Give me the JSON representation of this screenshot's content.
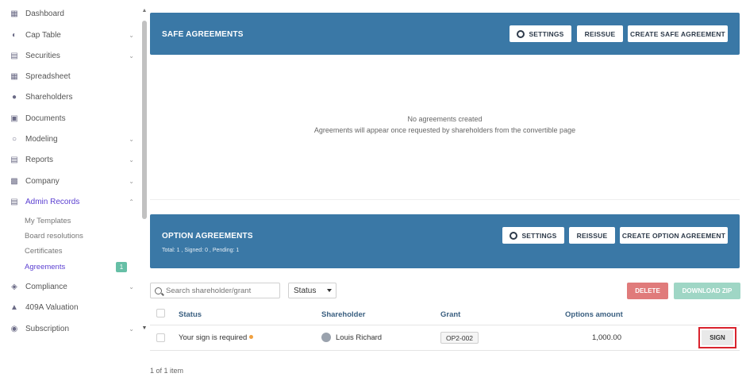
{
  "sidebar": {
    "items": [
      {
        "label": "Dashboard",
        "icon": "dashboard-icon",
        "chevron": false
      },
      {
        "label": "Cap Table",
        "icon": "pie-chart-icon",
        "chevron": true
      },
      {
        "label": "Securities",
        "icon": "clipboard-icon",
        "chevron": true
      },
      {
        "label": "Spreadsheet",
        "icon": "grid-icon",
        "chevron": false
      },
      {
        "label": "Shareholders",
        "icon": "user-icon",
        "chevron": false
      },
      {
        "label": "Documents",
        "icon": "folder-icon",
        "chevron": false
      },
      {
        "label": "Modeling",
        "icon": "lightbulb-icon",
        "chevron": true
      },
      {
        "label": "Reports",
        "icon": "report-icon",
        "chevron": true
      },
      {
        "label": "Company",
        "icon": "building-icon",
        "chevron": true
      },
      {
        "label": "Admin Records",
        "icon": "records-icon",
        "chevron": true,
        "active": true
      },
      {
        "label": "Compliance",
        "icon": "shield-check-icon",
        "chevron": true
      },
      {
        "label": "409A Valuation",
        "icon": "chart-icon",
        "chevron": false
      },
      {
        "label": "Subscription",
        "icon": "dollar-icon",
        "chevron": true
      }
    ],
    "sub_items": [
      {
        "label": "My Templates"
      },
      {
        "label": "Board resolutions"
      },
      {
        "label": "Certificates"
      },
      {
        "label": "Agreements",
        "active": true,
        "badge": "1"
      }
    ]
  },
  "safe": {
    "title": "SAFE AGREEMENTS",
    "settings_label": "SETTINGS",
    "reissue_label": "REISSUE",
    "create_label": "CREATE SAFE AGREEMENT",
    "empty_title": "No agreements created",
    "empty_desc": "Agreements will appear once requested by shareholders from the convertible page"
  },
  "option": {
    "title": "OPTION AGREEMENTS",
    "summary": "Total: 1 , Signed: 0 , Pending: 1",
    "settings_label": "SETTINGS",
    "reissue_label": "REISSUE",
    "create_label": "CREATE OPTION AGREEMENT"
  },
  "toolbar": {
    "search_placeholder": "Search shareholder/grant",
    "status_label": "Status",
    "delete_label": "DELETE",
    "download_label": "DOWNLOAD ZIP"
  },
  "table": {
    "headers": {
      "status": "Status",
      "shareholder": "Shareholder",
      "grant": "Grant",
      "options_amount": "Options amount"
    },
    "rows": [
      {
        "status": "Your sign is required",
        "shareholder": "Louis Richard",
        "grant": "OP2-002",
        "options_amount": "1,000.00",
        "action": "SIGN"
      }
    ]
  },
  "footer": {
    "count": "1 of 1 item"
  },
  "colors": {
    "header_blue": "#3a78a6",
    "accent_purple": "#5b3fd1",
    "badge_green": "#66bfa6",
    "delete_red": "#e07b7b",
    "zip_green": "#9fd6c5",
    "highlight_red": "#d9232d",
    "pending_orange": "#f0a040"
  }
}
